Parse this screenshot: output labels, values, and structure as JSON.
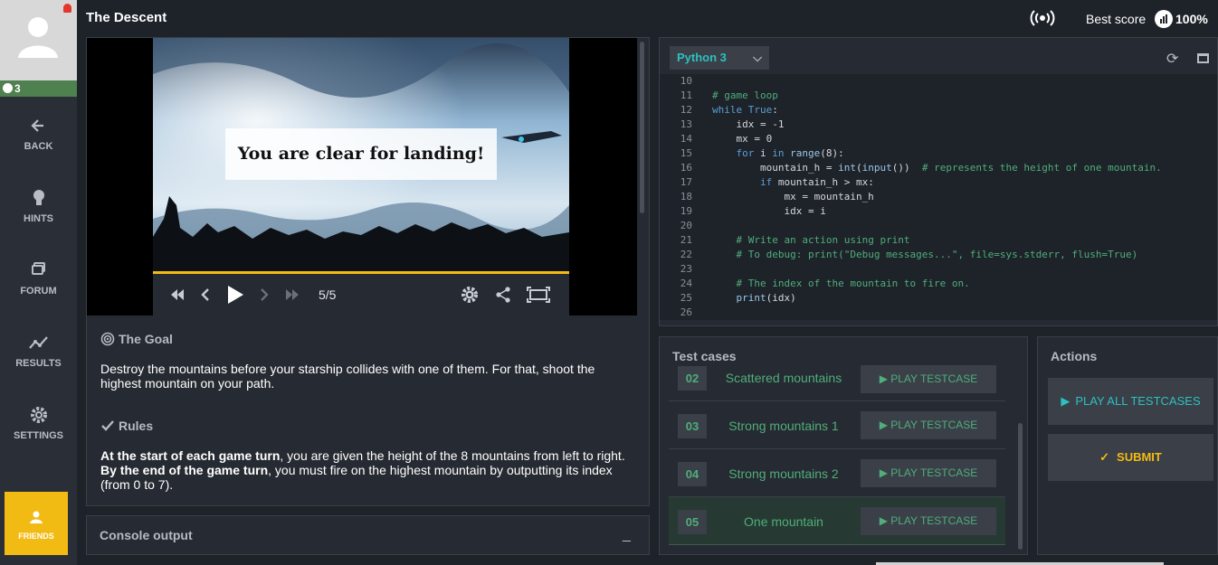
{
  "sidebar": {
    "level": "3",
    "items": [
      {
        "label": "BACK",
        "icon": "arrow-left-icon"
      },
      {
        "label": "HINTS",
        "icon": "lightbulb-icon"
      },
      {
        "label": "FORUM",
        "icon": "forum-icon"
      },
      {
        "label": "RESULTS",
        "icon": "trend-icon"
      },
      {
        "label": "SETTINGS",
        "icon": "gear-icon"
      }
    ],
    "friends_label": "FRIENDS"
  },
  "header": {
    "title": "The Descent",
    "best_score_label": "Best score",
    "best_score_value": "100%"
  },
  "viewer": {
    "banner_text": "You are clear for landing!",
    "frame_counter": "5/5",
    "progress": 1.0
  },
  "statement": {
    "goal_title": "The Goal",
    "goal_text": "Destroy the mountains before your starship collides with one of them. For that, shoot the highest mountain on your path.",
    "rules_title": "Rules",
    "rules_bold_1": "At the start of each game turn",
    "rules_text_1": ", you are given the height of the 8 mountains from left to right.",
    "rules_bold_2": "By the end of the game turn",
    "rules_text_2": ", you must fire on the highest mountain by outputting its index (from 0 to 7)."
  },
  "console": {
    "label": "Console output",
    "minimize": "_"
  },
  "editor": {
    "language": "Python 3",
    "lines": [
      {
        "n": "10",
        "parts": []
      },
      {
        "n": "11",
        "parts": [
          {
            "c": "cm",
            "t": "# game loop"
          }
        ]
      },
      {
        "n": "12",
        "parts": [
          {
            "c": "kw",
            "t": "while"
          },
          {
            "c": "tx",
            "t": " "
          },
          {
            "c": "kw",
            "t": "True"
          },
          {
            "c": "tx",
            "t": ":"
          }
        ]
      },
      {
        "n": "13",
        "parts": [
          {
            "c": "tx",
            "t": "    idx = -1"
          }
        ]
      },
      {
        "n": "14",
        "parts": [
          {
            "c": "tx",
            "t": "    mx = 0"
          }
        ]
      },
      {
        "n": "15",
        "parts": [
          {
            "c": "tx",
            "t": "    "
          },
          {
            "c": "kw",
            "t": "for"
          },
          {
            "c": "tx",
            "t": " i "
          },
          {
            "c": "kw",
            "t": "in"
          },
          {
            "c": "tx",
            "t": " "
          },
          {
            "c": "bi",
            "t": "range"
          },
          {
            "c": "tx",
            "t": "(8):"
          }
        ]
      },
      {
        "n": "16",
        "parts": [
          {
            "c": "tx",
            "t": "        mountain_h = "
          },
          {
            "c": "bi",
            "t": "int"
          },
          {
            "c": "tx",
            "t": "("
          },
          {
            "c": "bi",
            "t": "input"
          },
          {
            "c": "tx",
            "t": "())  "
          },
          {
            "c": "cm",
            "t": "# represents the height of one mountain."
          }
        ]
      },
      {
        "n": "17",
        "parts": [
          {
            "c": "tx",
            "t": "        "
          },
          {
            "c": "kw",
            "t": "if"
          },
          {
            "c": "tx",
            "t": " mountain_h > mx:"
          }
        ]
      },
      {
        "n": "18",
        "parts": [
          {
            "c": "tx",
            "t": "            mx = mountain_h"
          }
        ]
      },
      {
        "n": "19",
        "parts": [
          {
            "c": "tx",
            "t": "            idx = i"
          }
        ]
      },
      {
        "n": "20",
        "parts": []
      },
      {
        "n": "21",
        "parts": [
          {
            "c": "tx",
            "t": "    "
          },
          {
            "c": "cm",
            "t": "# Write an action using print"
          }
        ]
      },
      {
        "n": "22",
        "parts": [
          {
            "c": "tx",
            "t": "    "
          },
          {
            "c": "cm",
            "t": "# To debug: print(\"Debug messages...\", file=sys.stderr, flush=True)"
          }
        ]
      },
      {
        "n": "23",
        "parts": []
      },
      {
        "n": "24",
        "parts": [
          {
            "c": "tx",
            "t": "    "
          },
          {
            "c": "cm",
            "t": "# The index of the mountain to fire on."
          }
        ]
      },
      {
        "n": "25",
        "parts": [
          {
            "c": "tx",
            "t": "    "
          },
          {
            "c": "bi",
            "t": "print"
          },
          {
            "c": "tx",
            "t": "(idx)"
          }
        ]
      },
      {
        "n": "26",
        "parts": []
      }
    ]
  },
  "tests": {
    "label": "Test cases",
    "play_label": "▶ PLAY TESTCASE",
    "items": [
      {
        "num": "02",
        "name": "Scattered mountains"
      },
      {
        "num": "03",
        "name": "Strong mountains 1"
      },
      {
        "num": "04",
        "name": "Strong mountains 2"
      },
      {
        "num": "05",
        "name": "One mountain"
      }
    ]
  },
  "actions": {
    "label": "Actions",
    "play_all": "PLAY ALL TESTCASES",
    "submit": "SUBMIT"
  },
  "colors": {
    "accent": "#f2bb13",
    "success": "#4fae7a",
    "teal": "#2dc1c0"
  }
}
